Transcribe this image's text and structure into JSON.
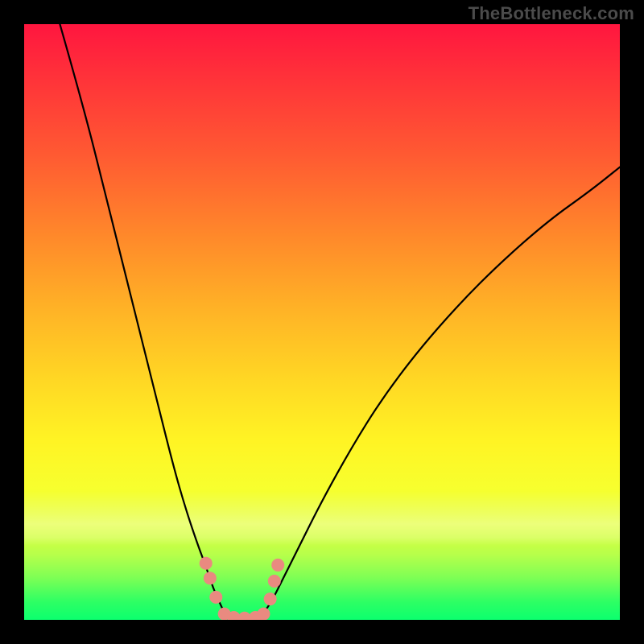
{
  "watermark": "TheBottleneck.com",
  "chart_data": {
    "type": "line",
    "title": "",
    "xlabel": "",
    "ylabel": "",
    "xlim": [
      0,
      100
    ],
    "ylim": [
      0,
      100
    ],
    "grid": false,
    "legend": false,
    "background": "rainbow-vertical-gradient",
    "series": [
      {
        "name": "left-branch",
        "x": [
          6,
          10,
          14,
          18,
          22,
          25,
          27,
          29,
          30.5,
          31.5,
          32.3,
          33,
          33.6
        ],
        "y": [
          100,
          86,
          70,
          54,
          38,
          26,
          19,
          13,
          9,
          6,
          4,
          2.5,
          1.2
        ]
      },
      {
        "name": "bottom-flat",
        "x": [
          33.6,
          34.5,
          36,
          37.5,
          39,
          40.2
        ],
        "y": [
          1.2,
          0.6,
          0.3,
          0.3,
          0.6,
          1.2
        ]
      },
      {
        "name": "right-branch",
        "x": [
          40.2,
          41.5,
          43.5,
          46,
          50,
          55,
          60,
          66,
          73,
          80,
          88,
          95,
          100
        ],
        "y": [
          1.2,
          3,
          7,
          12,
          20,
          29,
          37,
          45,
          53,
          60,
          67,
          72,
          76
        ]
      }
    ],
    "markers": {
      "name": "bottom-dots",
      "color": "#e98a80",
      "radius_px": 8,
      "points": [
        {
          "x": 30.5,
          "y": 9.5
        },
        {
          "x": 31.2,
          "y": 7.0
        },
        {
          "x": 32.2,
          "y": 3.8
        },
        {
          "x": 33.6,
          "y": 1.0
        },
        {
          "x": 35.2,
          "y": 0.4
        },
        {
          "x": 37.0,
          "y": 0.3
        },
        {
          "x": 38.8,
          "y": 0.4
        },
        {
          "x": 40.2,
          "y": 1.0
        },
        {
          "x": 41.3,
          "y": 3.5
        },
        {
          "x": 42.0,
          "y": 6.5
        },
        {
          "x": 42.6,
          "y": 9.2
        }
      ]
    }
  }
}
